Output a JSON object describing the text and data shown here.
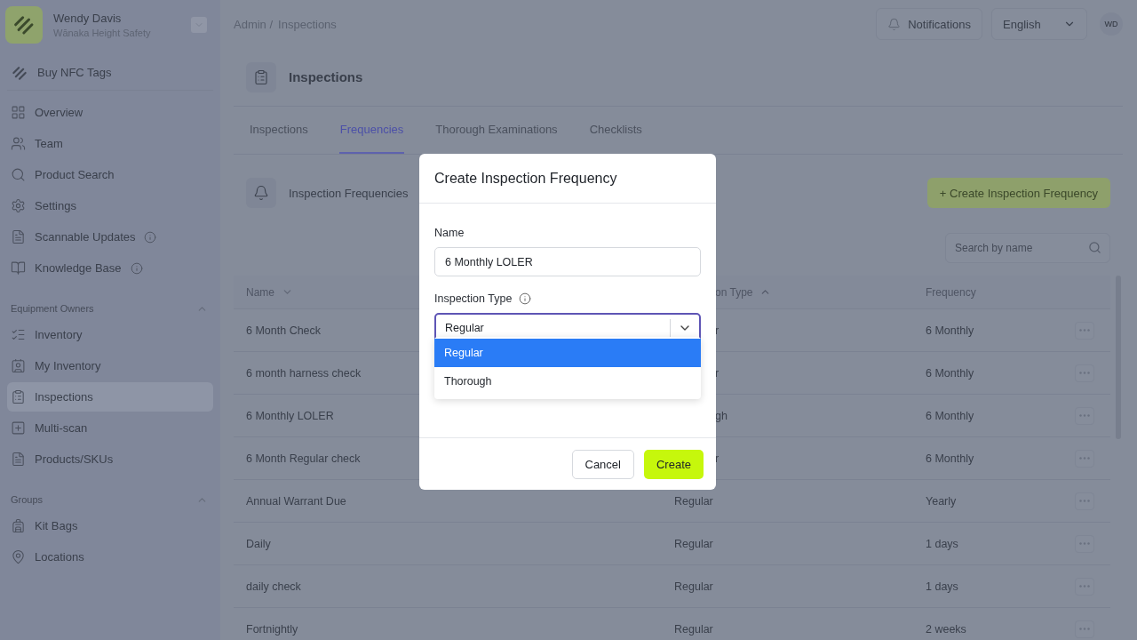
{
  "account": {
    "name": "Wendy Davis",
    "company": "Wānaka Height Safety"
  },
  "sidebar": {
    "promo": {
      "label": "Buy NFC Tags"
    },
    "items": [
      {
        "label": "Overview",
        "info": false,
        "selected": false
      },
      {
        "label": "Team",
        "info": false,
        "selected": false
      },
      {
        "label": "Product Search",
        "info": false,
        "selected": false
      },
      {
        "label": "Settings",
        "info": false,
        "selected": false
      },
      {
        "label": "Scannable Updates",
        "info": true,
        "selected": false
      },
      {
        "label": "Knowledge Base",
        "info": true,
        "selected": false
      }
    ],
    "sections": [
      {
        "title": "Equipment Owners",
        "expanded": true,
        "items": [
          {
            "label": "Inventory",
            "selected": false
          },
          {
            "label": "My Inventory",
            "selected": false
          },
          {
            "label": "Inspections",
            "selected": true
          },
          {
            "label": "Multi-scan",
            "selected": false
          },
          {
            "label": "Products/SKUs",
            "selected": false
          }
        ]
      },
      {
        "title": "Groups",
        "expanded": true,
        "items": [
          {
            "label": "Kit Bags",
            "selected": false
          },
          {
            "label": "Locations",
            "selected": false
          }
        ]
      }
    ]
  },
  "breadcrumb": [
    "Admin /",
    "Inspections"
  ],
  "topbar": {
    "notifications": "Notifications",
    "language": "English",
    "avatar": "WD"
  },
  "page_title": "Inspections",
  "tabs": [
    {
      "label": "Inspections",
      "selected": false
    },
    {
      "label": "Frequencies",
      "selected": true
    },
    {
      "label": "Thorough Examinations",
      "selected": false
    },
    {
      "label": "Checklists",
      "selected": false
    }
  ],
  "section": {
    "title": "Inspection Frequencies",
    "create_button": "+ Create Inspection Frequency",
    "search": {
      "placeholder": "Search by name"
    }
  },
  "table": {
    "columns": [
      "Name",
      "on Type",
      "Frequency"
    ],
    "rows": [
      {
        "name": "6 Month Check",
        "type": "r",
        "frequency": "6 Monthly"
      },
      {
        "name": "6 month harness check",
        "type": "r",
        "frequency": "6 Monthly"
      },
      {
        "name": "6 Monthly LOLER",
        "type": "gh",
        "frequency": "6 Monthly"
      },
      {
        "name": "6 Month Regular check",
        "type": "r",
        "frequency": "6 Monthly"
      },
      {
        "name": "Annual Warrant Due",
        "type": "Regular",
        "frequency": "Yearly"
      },
      {
        "name": "Daily",
        "type": "Regular",
        "frequency": "1 days"
      },
      {
        "name": "daily check",
        "type": "Regular",
        "frequency": "1 days"
      },
      {
        "name": "Fortnightly",
        "type": "Regular",
        "frequency": "2 weeks"
      }
    ]
  },
  "dialog": {
    "title": "Create Inspection Frequency",
    "name_label": "Name",
    "name_value": "6 Monthly LOLER",
    "type_label": "Inspection Type",
    "type_value": "Regular",
    "options": [
      {
        "label": "Regular",
        "selected": true
      },
      {
        "label": "Thorough",
        "selected": false
      }
    ],
    "buttons": [
      {
        "label": "Cancel",
        "kind": "secondary"
      },
      {
        "label": "Create",
        "kind": "primary"
      }
    ]
  }
}
